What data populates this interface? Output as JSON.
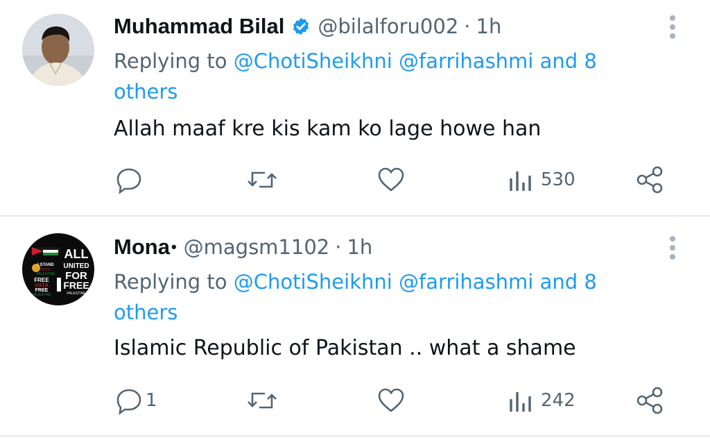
{
  "tweets": [
    {
      "name": "Muhammad Bilal",
      "verified": true,
      "handle": "@bilalforu002",
      "separator": "·",
      "time": "1h",
      "replying_to_label": "Replying to",
      "mention_1": "@ChotiSheikhni",
      "mention_2": "@farrihashmi",
      "and_label": "and",
      "others_link": "8 others",
      "text": "Allah maaf kre kis kam ko lage howe han",
      "reply_count": "",
      "views": "530"
    },
    {
      "name": "Mona",
      "name_suffix": "•",
      "handle": "@magsm1102",
      "separator": "·",
      "time": "1h",
      "replying_to_label": "Replying to",
      "mention_1": "@ChotiSheikhni",
      "mention_2": "@farrihashmi",
      "and_label": "and",
      "others_link": "8 others",
      "text": "Islamic Republic of Pakistan .. what a shame",
      "reply_count": "1",
      "views": "242",
      "avatar_text": {
        "line1": "ALL",
        "line2": "UNITED",
        "line3": "FOR",
        "line4": "FREE",
        "line5": "PALESTINE",
        "left1": "I STAND",
        "left2": "WITH",
        "left3": "PALESTINE",
        "left4": "FREE",
        "left5": "GAZA",
        "left6": "FREE",
        "left7": "PALESTINE"
      }
    }
  ],
  "icons": {
    "reply": "reply-icon",
    "retweet": "retweet-icon",
    "like": "heart-icon",
    "views": "views-icon",
    "share": "share-icon",
    "more": "more-vertical-icon",
    "verified": "verified-badge-icon"
  },
  "colors": {
    "link": "#1d9bf0",
    "secondary": "#536471",
    "verified": "#1d9bf0"
  }
}
